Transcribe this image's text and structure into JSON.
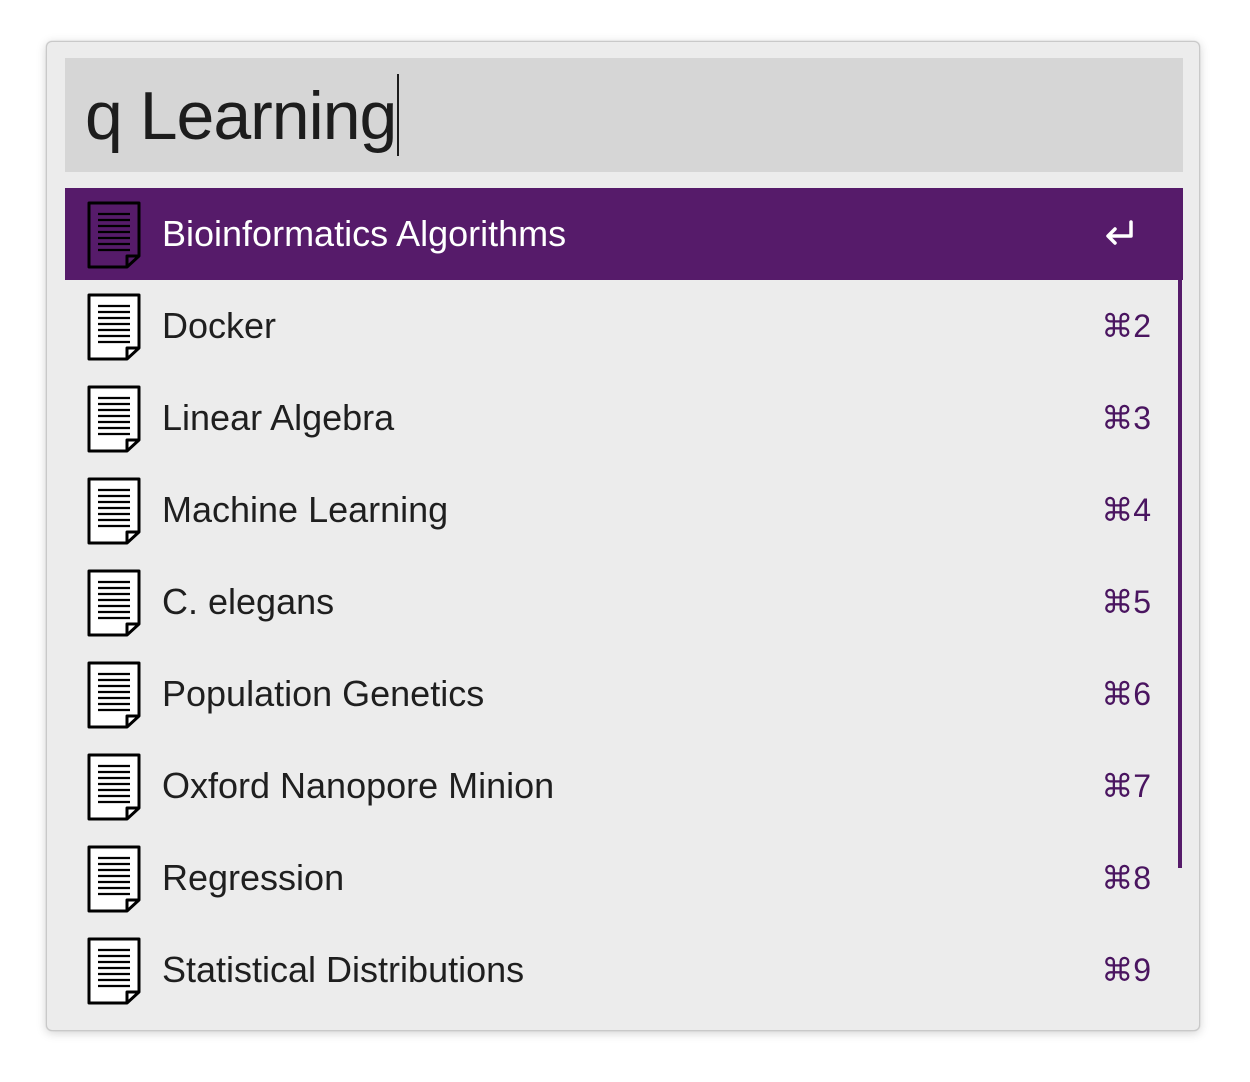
{
  "search": {
    "query": "q Learning"
  },
  "colors": {
    "accent": "#561b6a",
    "shortcut_text": "#4a1560",
    "window_bg": "#ececec",
    "search_bg": "#d6d6d6"
  },
  "results": [
    {
      "title": "Bioinformatics Algorithms",
      "shortcut": "",
      "icon": "document-icon",
      "selected": true,
      "action_icon": "return-key-icon"
    },
    {
      "title": "Docker",
      "shortcut": "⌘2",
      "icon": "document-icon",
      "selected": false
    },
    {
      "title": "Linear Algebra",
      "shortcut": "⌘3",
      "icon": "document-icon",
      "selected": false
    },
    {
      "title": "Machine Learning",
      "shortcut": "⌘4",
      "icon": "document-icon",
      "selected": false
    },
    {
      "title": "C. elegans",
      "shortcut": "⌘5",
      "icon": "document-icon",
      "selected": false
    },
    {
      "title": "Population Genetics",
      "shortcut": "⌘6",
      "icon": "document-icon",
      "selected": false
    },
    {
      "title": "Oxford Nanopore Minion",
      "shortcut": "⌘7",
      "icon": "document-icon",
      "selected": false
    },
    {
      "title": "Regression",
      "shortcut": "⌘8",
      "icon": "document-icon",
      "selected": false
    },
    {
      "title": "Statistical Distributions",
      "shortcut": "⌘9",
      "icon": "document-icon",
      "selected": false
    }
  ]
}
